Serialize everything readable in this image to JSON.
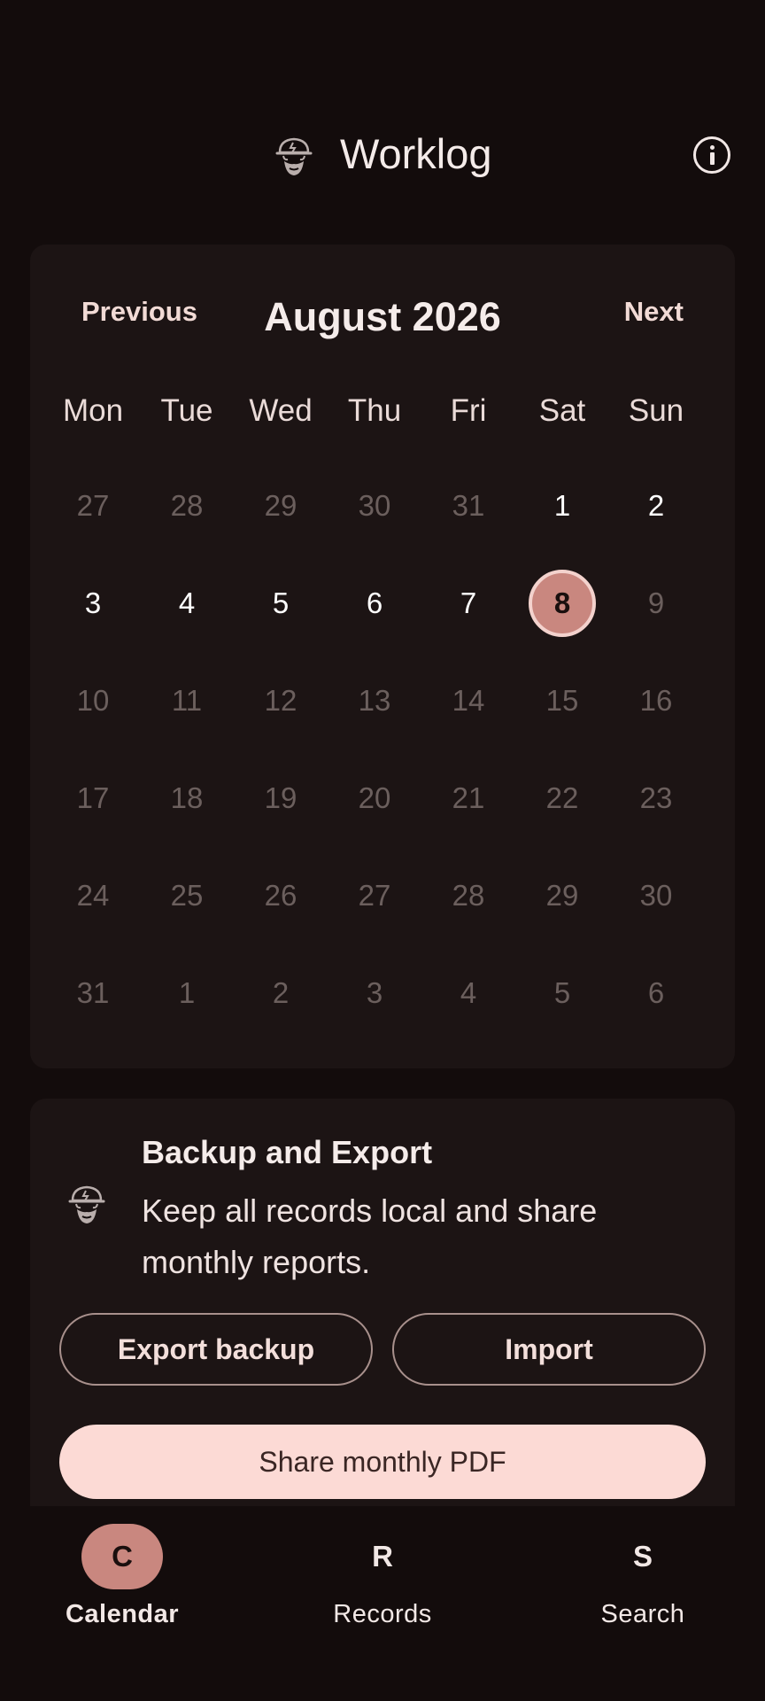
{
  "app": {
    "title": "Worklog"
  },
  "icons": {
    "logo": "bearded-worker-icon",
    "info": "info-icon"
  },
  "calendar": {
    "prev_label": "Previous",
    "next_label": "Next",
    "month_title": "August 2026",
    "weekdays": [
      "Mon",
      "Tue",
      "Wed",
      "Thu",
      "Fri",
      "Sat",
      "Sun"
    ],
    "weeks": [
      [
        "27",
        "28",
        "29",
        "30",
        "31",
        "1",
        "2"
      ],
      [
        "3",
        "4",
        "5",
        "6",
        "7",
        "8",
        "9"
      ],
      [
        "10",
        "11",
        "12",
        "13",
        "14",
        "15",
        "16"
      ],
      [
        "17",
        "18",
        "19",
        "20",
        "21",
        "22",
        "23"
      ],
      [
        "24",
        "25",
        "26",
        "27",
        "28",
        "29",
        "30"
      ],
      [
        "31",
        "1",
        "2",
        "3",
        "4",
        "5",
        "6"
      ]
    ],
    "selected_day": "8"
  },
  "backup": {
    "title": "Backup and Export",
    "description": "Keep all records local and share monthly reports.",
    "export_label": "Export backup",
    "import_label": "Import",
    "share_label": "Share monthly PDF"
  },
  "nav": {
    "items": [
      {
        "letter": "C",
        "label": "Calendar",
        "active": true
      },
      {
        "letter": "R",
        "label": "Records",
        "active": false
      },
      {
        "letter": "S",
        "label": "Search",
        "active": false
      }
    ]
  },
  "colors": {
    "background": "#130c0c",
    "card": "#1c1414",
    "accent": "#c9877f",
    "accent_light": "#fcdad5"
  }
}
